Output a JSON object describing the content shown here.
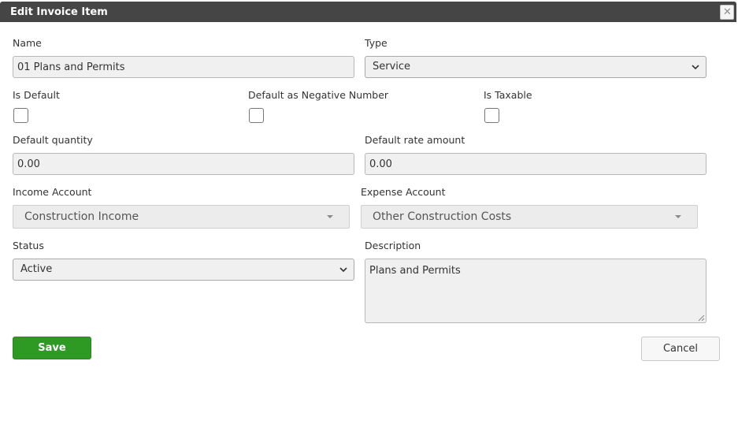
{
  "dialog": {
    "title": "Edit Invoice Item",
    "close_icon": "close-icon"
  },
  "form": {
    "name": {
      "label": "Name",
      "value": "01 Plans and Permits"
    },
    "type": {
      "label": "Type",
      "value": "Service",
      "icon": "chevron-down-icon"
    },
    "is_default": {
      "label": "Is Default",
      "checked": false
    },
    "default_negative": {
      "label": "Default as Negative Number",
      "checked": false
    },
    "is_taxable": {
      "label": "Is Taxable",
      "checked": false
    },
    "default_quantity": {
      "label": "Default quantity",
      "value": "0.00"
    },
    "default_rate": {
      "label": "Default rate amount",
      "value": "0.00"
    },
    "income_account": {
      "label": "Income Account",
      "value": "Construction Income",
      "icon": "caret-down-icon"
    },
    "expense_account": {
      "label": "Expense Account",
      "value": "Other Construction Costs",
      "icon": "caret-down-icon"
    },
    "status": {
      "label": "Status",
      "value": "Active",
      "icon": "chevron-down-icon"
    },
    "description": {
      "label": "Description",
      "value": "Plans and Permits",
      "icon": "resize-grip-icon"
    }
  },
  "actions": {
    "save_label": "Save",
    "cancel_label": "Cancel"
  },
  "colors": {
    "titlebar": "#454545",
    "save_button": "#2e9a23",
    "field_background": "#f0f0f0"
  }
}
